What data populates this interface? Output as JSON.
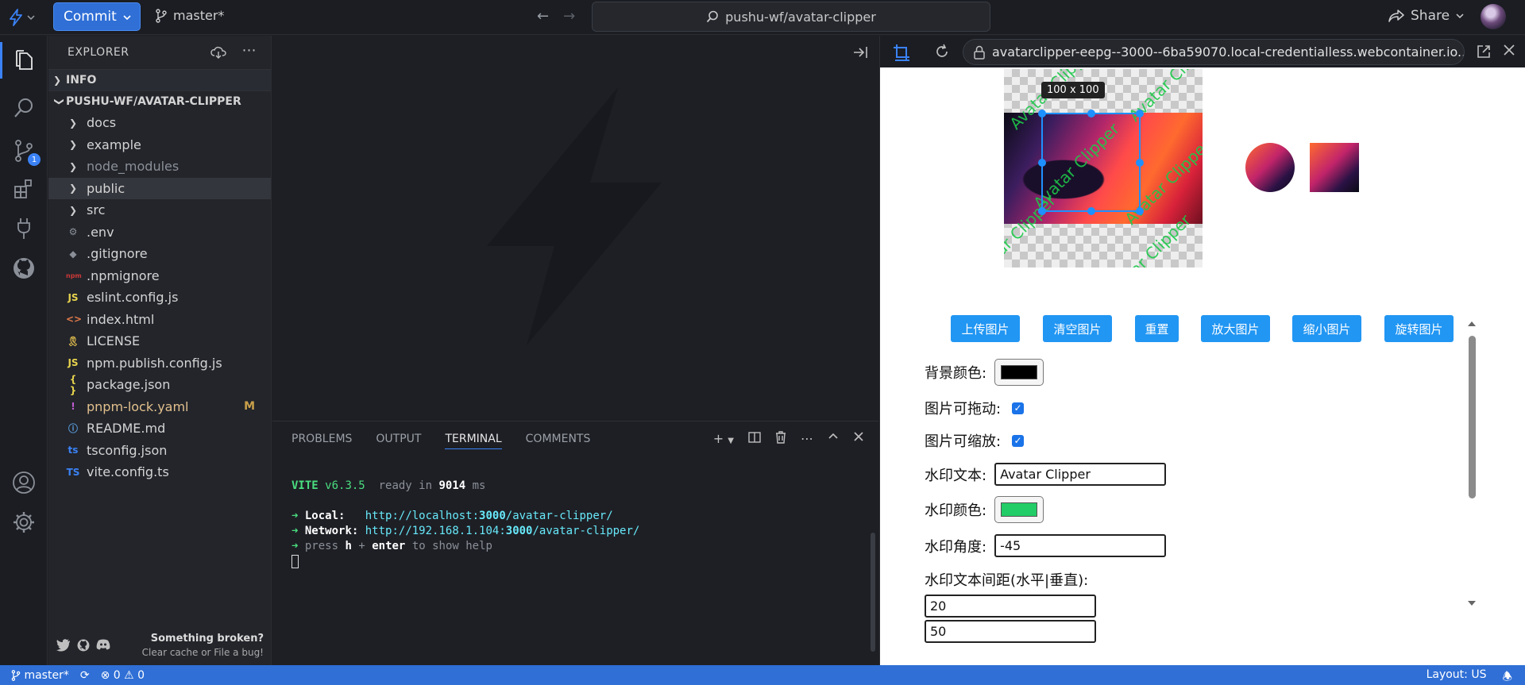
{
  "topbar": {
    "commit_label": "Commit",
    "branch": "master*",
    "project": "pushu-wf/avatar-clipper",
    "share_label": "Share"
  },
  "activity": {
    "scm_badge": "1"
  },
  "explorer": {
    "title": "EXPLORER",
    "sections": {
      "info": "INFO",
      "project": "PUSHU-WF/AVATAR-CLIPPER"
    },
    "items": [
      {
        "label": "docs",
        "icon": "chevron-right"
      },
      {
        "label": "example",
        "icon": "chevron-right"
      },
      {
        "label": "node_modules",
        "icon": "chevron-right"
      },
      {
        "label": "public",
        "icon": "chevron-right"
      },
      {
        "label": "src",
        "icon": "chevron-right"
      },
      {
        "label": ".env",
        "icon": "gear"
      },
      {
        "label": ".gitignore",
        "icon": "git"
      },
      {
        "label": ".npmignore",
        "icon": "npm"
      },
      {
        "label": "eslint.config.js",
        "icon": "JS"
      },
      {
        "label": "index.html",
        "icon": "html"
      },
      {
        "label": "LICENSE",
        "icon": "license"
      },
      {
        "label": "npm.publish.config.js",
        "icon": "JS"
      },
      {
        "label": "package.json",
        "icon": "{}"
      },
      {
        "label": "pnpm-lock.yaml",
        "icon": "!",
        "status": "M"
      },
      {
        "label": "README.md",
        "icon": "info"
      },
      {
        "label": "tsconfig.json",
        "icon": "ts"
      },
      {
        "label": "vite.config.ts",
        "icon": "TS"
      }
    ],
    "footer": {
      "title": "Something broken?",
      "subtitle": "Clear cache or File a bug!"
    }
  },
  "panel": {
    "tabs": [
      "PROBLEMS",
      "OUTPUT",
      "TERMINAL",
      "COMMENTS"
    ],
    "active_tab": "TERMINAL",
    "terminal": {
      "vite": "VITE",
      "version": "v6.3.5",
      "ready": "ready in",
      "ms_value": "9014",
      "ms_unit": "ms",
      "local_label": "Local:",
      "local_url_a": "http://localhost:",
      "local_port": "3000",
      "local_url_b": "/avatar-clipper/",
      "network_label": "Network:",
      "network_url_a": "http://192.168.1.104:",
      "network_port": "3000",
      "network_url_b": "/avatar-clipper/",
      "help_a": "press",
      "help_h": "h",
      "help_plus": "+",
      "help_enter": "enter",
      "help_b": "to show help"
    }
  },
  "preview": {
    "url": "avatarclipper-eepg--3000--6ba59070.local-credentialless.webcontainer.io...",
    "size_tip": "100 x 100",
    "watermark": "Avatar Clipper",
    "buttons": [
      "上传图片",
      "清空图片",
      "重置",
      "放大图片",
      "缩小图片",
      "旋转图片"
    ],
    "form": {
      "bg_color_label": "背景颜色:",
      "bg_color": "#000000",
      "draggable_label": "图片可拖动:",
      "zoomable_label": "图片可缩放:",
      "wm_text_label": "水印文本:",
      "wm_text_value": "Avatar Clipper",
      "wm_color_label": "水印颜色:",
      "wm_color": "#22cc66",
      "wm_angle_label": "水印角度:",
      "wm_angle_value": "-45",
      "wm_gap_label": "水印文本间距(水平|垂直):",
      "wm_gap_h": "20",
      "wm_gap_v": "50"
    }
  },
  "statusbar": {
    "branch": "master*",
    "errors": "0",
    "warnings": "0",
    "layout": "Layout: US"
  },
  "colors": {
    "accent": "#2f6fd6",
    "preview_button": "#2196f3"
  }
}
